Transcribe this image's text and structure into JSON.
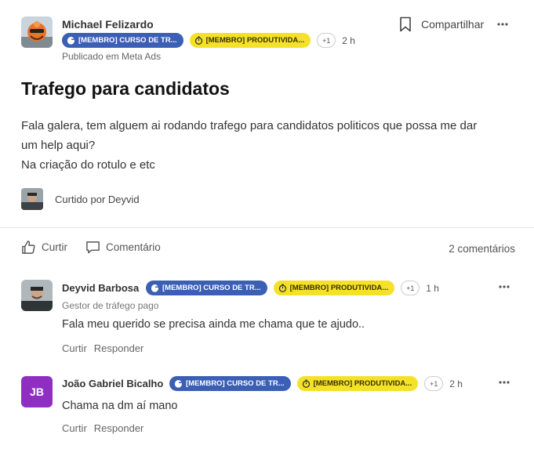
{
  "post": {
    "author": {
      "name": "Michael Felizardo",
      "avatar_icon": "user-photo-orange"
    },
    "badges": [
      {
        "label": "[MEMBRO] CURSO DE TR...",
        "color": "#3a5fb5",
        "icon": "course-icon"
      },
      {
        "label": "[MEMBRO] PRODUTIVIDA...",
        "color": "#f5e12a",
        "icon": "stopwatch-icon"
      }
    ],
    "extra_badges": "+1",
    "time": "2 h",
    "published_in": "Publicado em Meta Ads",
    "share_label": "Compartilhar",
    "title": "Trafego para candidatos",
    "body_lines": [
      "Fala galera, tem alguem ai rodando trafego para candidatos politicos que possa me dar",
      "um help aqui?",
      "Na criação do rotulo e etc"
    ],
    "liked_by": "Curtido por Deyvid"
  },
  "actions": {
    "like_label": "Curtir",
    "comment_label": "Comentário",
    "comment_count": "2 comentários"
  },
  "comments": [
    {
      "name": "Deyvid Barbosa",
      "badge1": "[MEMBRO] CURSO DE TR...",
      "badge2": "[MEMBRO] PRODUTIVIDA...",
      "extra": "+1",
      "time": "1 h",
      "subtitle": "Gestor de tráfego pago",
      "text": "Fala meu querido se precisa ainda me chama que te ajudo..",
      "like": "Curtir",
      "reply": "Responder"
    },
    {
      "name": "João Gabriel Bicalho",
      "initials": "JB",
      "badge1": "[MEMBRO] CURSO DE TR...",
      "badge2": "[MEMBRO] PRODUTIVIDA...",
      "extra": "+1",
      "time": "2 h",
      "text": "Chama na dm aí mano",
      "like": "Curtir",
      "reply": "Responder"
    }
  ]
}
